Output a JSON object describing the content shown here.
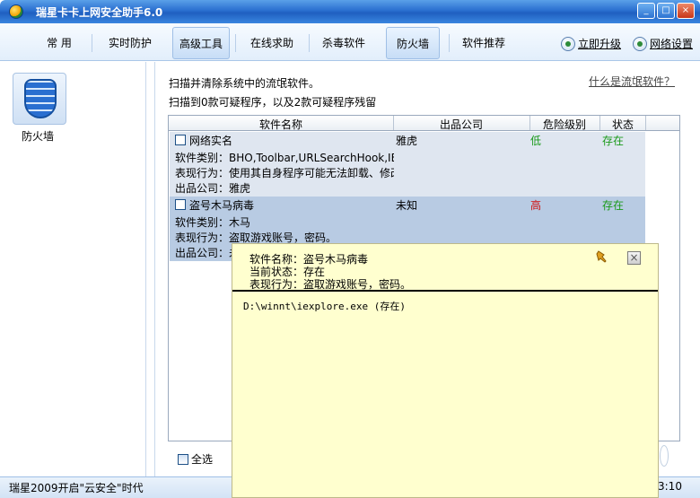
{
  "window": {
    "title": "瑞星卡卡上网安全助手6.0",
    "min": "_",
    "max": "□",
    "close": "×"
  },
  "tabs": [
    {
      "label": "常  用"
    },
    {
      "label": "实时防护"
    },
    {
      "label": "高级工具"
    },
    {
      "label": "在线求助"
    },
    {
      "label": "杀毒软件"
    },
    {
      "label": "防火墙"
    },
    {
      "label": "软件推荐"
    }
  ],
  "top_links": {
    "upgrade": "立即升级",
    "network": "网络设置"
  },
  "sidebar": {
    "item_label": "防火墙"
  },
  "main": {
    "desc1": "扫描并清除系统中的流氓软件。",
    "desc2": "扫描到0款可疑程序，以及2款可疑程序残留",
    "help_link": "什么是流氓软件？",
    "columns": [
      "软件名称",
      "出品公司",
      "危险级别",
      "状态"
    ],
    "rows": [
      {
        "name": "网络实名",
        "company": "雅虎",
        "level": "低",
        "status": "存在",
        "category": "软件类别：BHO,Toolbar,URLSearchHook,IE额外",
        "behavior": "表现行为：使用其自身程序可能无法卸载、修改",
        "vendor": "出品公司：雅虎"
      },
      {
        "name": "盗号木马病毒",
        "company": "未知",
        "level": "高",
        "status": "存在",
        "category": "软件类别：木马",
        "behavior": "表现行为：盗取游戏账号，密码。",
        "vendor": "出品公司：未"
      }
    ],
    "select_all": "全选"
  },
  "popup": {
    "name_line": "软件名称：盗号木马病毒",
    "status_line": "当前状态：存在",
    "behavior_line": "表现行为：盗取游戏账号，密码。",
    "path": "D:\\winnt\\iexplore.exe  (存在)"
  },
  "status": {
    "text": "瑞星2009开启\"云安全\"时代",
    "time": "3:10"
  },
  "colors": {
    "accent": "#2a6fd0",
    "low": "#1a9a1a",
    "high": "#d01010",
    "popup_bg": "#ffffcf"
  }
}
